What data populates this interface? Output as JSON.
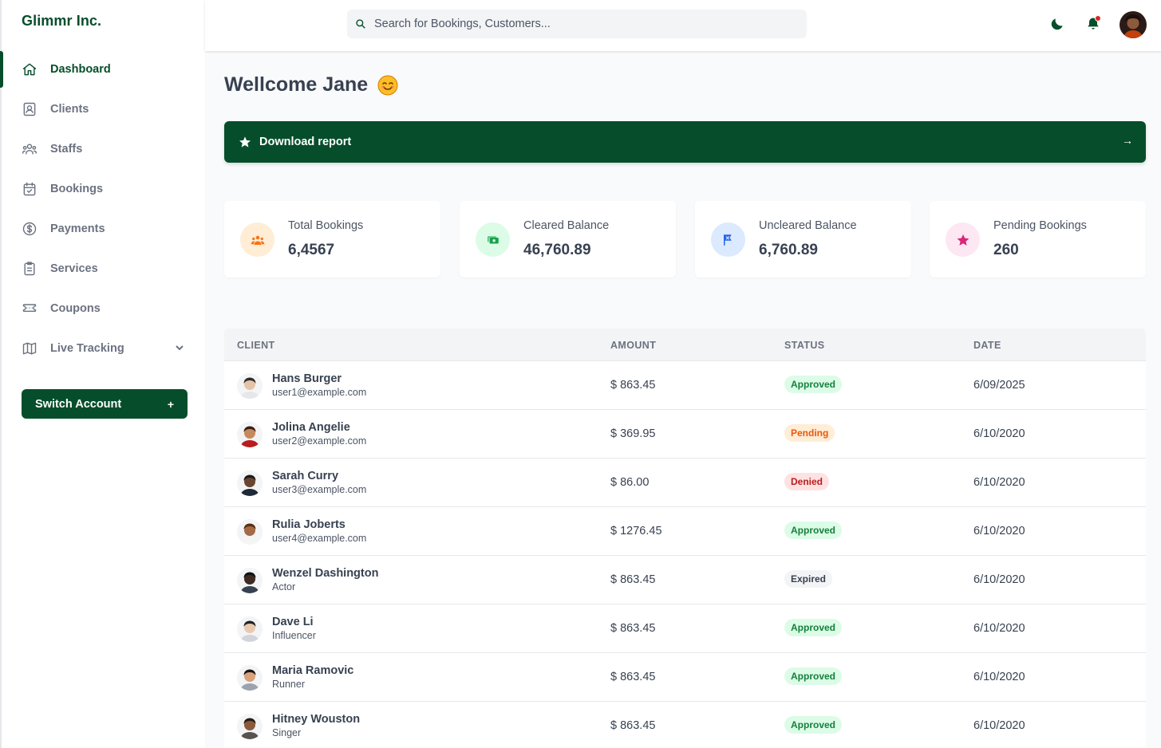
{
  "brand": "Glimmr Inc.",
  "colors": {
    "primary": "#064e2b",
    "notification_dot": "#dc2626"
  },
  "sidebar": {
    "items": [
      {
        "label": "Dashboard",
        "icon": "home-icon",
        "active": true
      },
      {
        "label": "Clients",
        "icon": "id-card-icon"
      },
      {
        "label": "Staffs",
        "icon": "users-icon"
      },
      {
        "label": "Bookings",
        "icon": "calendar-check-icon"
      },
      {
        "label": "Payments",
        "icon": "dollar-circle-icon"
      },
      {
        "label": "Services",
        "icon": "clipboard-icon"
      },
      {
        "label": "Coupons",
        "icon": "ticket-icon"
      },
      {
        "label": "Live Tracking",
        "icon": "map-icon",
        "expandable": true
      }
    ],
    "switch_account_label": "Switch Account",
    "switch_account_symbol": "+"
  },
  "header": {
    "search_placeholder": "Search for Bookings, Customers...",
    "icons": [
      "moon-icon",
      "bell-icon",
      "avatar"
    ]
  },
  "main": {
    "greeting": "Wellcome Jane",
    "banner_label": "Download report",
    "banner_arrow": "→",
    "cards": [
      {
        "label": "Total Bookings",
        "value": "6,4567",
        "icon": "users-group-icon",
        "color": "#f97316",
        "bg": "#ffedd5"
      },
      {
        "label": "Cleared Balance",
        "value": "46,760.89",
        "icon": "cash-icon",
        "color": "#16a34a",
        "bg": "#dcfce7"
      },
      {
        "label": "Uncleared Balance",
        "value": "6,760.89",
        "icon": "flag-icon",
        "color": "#2563eb",
        "bg": "#dbeafe"
      },
      {
        "label": "Pending Bookings",
        "value": "260",
        "icon": "star-icon",
        "color": "#db2777",
        "bg": "#fce7f3"
      }
    ]
  },
  "table": {
    "headers": {
      "client": "CLIENT",
      "amount": "AMOUNT",
      "status": "STATUS",
      "date": "DATE"
    },
    "rows": [
      {
        "name": "Hans Burger",
        "sub": "user1@example.com",
        "amount": "$ 863.45",
        "status": "Approved",
        "date": "6/09/2025"
      },
      {
        "name": "Jolina Angelie",
        "sub": "user2@example.com",
        "amount": "$ 369.95",
        "status": "Pending",
        "date": "6/10/2020"
      },
      {
        "name": "Sarah Curry",
        "sub": "user3@example.com",
        "amount": "$ 86.00",
        "status": "Denied",
        "date": "6/10/2020"
      },
      {
        "name": "Rulia Joberts",
        "sub": "user4@example.com",
        "amount": "$ 1276.45",
        "status": "Approved",
        "date": "6/10/2020"
      },
      {
        "name": "Wenzel Dashington",
        "sub": "Actor",
        "amount": "$ 863.45",
        "status": "Expired",
        "date": "6/10/2020"
      },
      {
        "name": "Dave Li",
        "sub": "Influencer",
        "amount": "$ 863.45",
        "status": "Approved",
        "date": "6/10/2020"
      },
      {
        "name": "Maria Ramovic",
        "sub": "Runner",
        "amount": "$ 863.45",
        "status": "Approved",
        "date": "6/10/2020"
      },
      {
        "name": "Hitney Wouston",
        "sub": "Singer",
        "amount": "$ 863.45",
        "status": "Approved",
        "date": "6/10/2020"
      }
    ]
  }
}
